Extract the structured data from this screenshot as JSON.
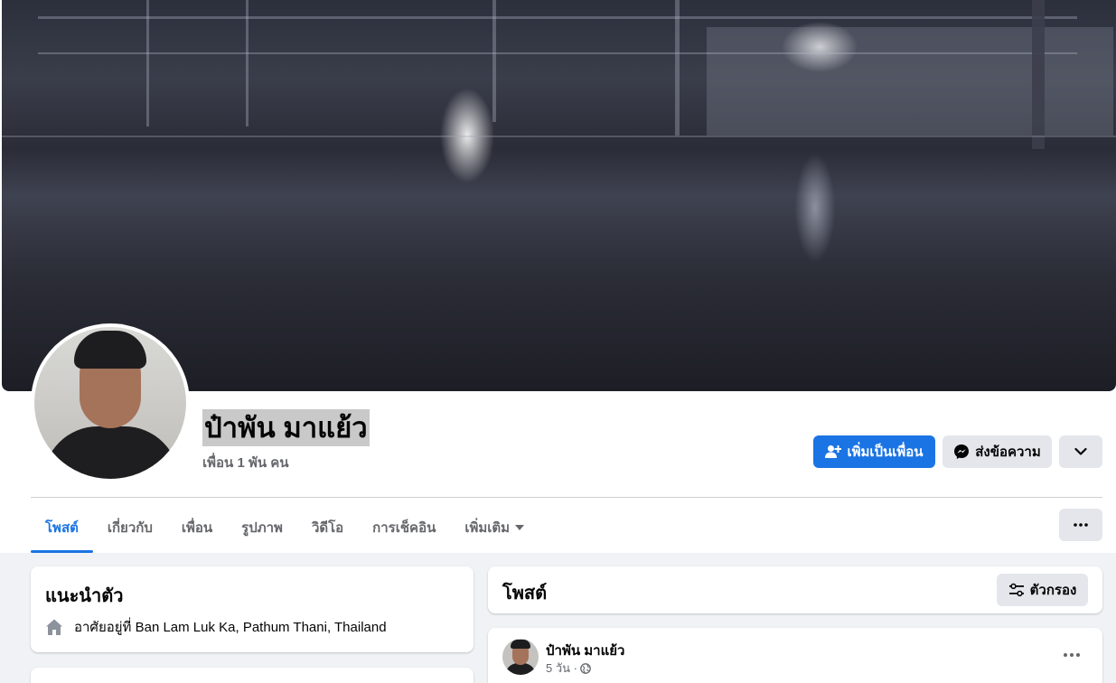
{
  "profile": {
    "name": "ป๋าพัน มาแย้ว",
    "friends": "เพื่อน 1 พัน คน"
  },
  "actions": {
    "add_friend": "เพิ่มเป็นเพื่อน",
    "message": "ส่งข้อความ"
  },
  "tabs": [
    {
      "label": "โพสต์",
      "active": true
    },
    {
      "label": "เกี่ยวกับ"
    },
    {
      "label": "เพื่อน"
    },
    {
      "label": "รูปภาพ"
    },
    {
      "label": "วิดีโอ"
    },
    {
      "label": "การเช็คอิน"
    },
    {
      "label": "เพิ่มเติม"
    }
  ],
  "intro": {
    "title": "แนะนำตัว",
    "lives_in": "อาศัยอยู่ที่ Ban Lam Luk Ka, Pathum Thani, Thailand"
  },
  "posts": {
    "title": "โพสต์",
    "filter_label": "ตัวกรอง",
    "items": [
      {
        "author": "ป๋าพัน มาแย้ว",
        "time": "5 วัน ·"
      }
    ]
  },
  "colors": {
    "accent": "#1b74e4",
    "button_gray": "#e4e6eb",
    "background": "#f0f2f5"
  }
}
